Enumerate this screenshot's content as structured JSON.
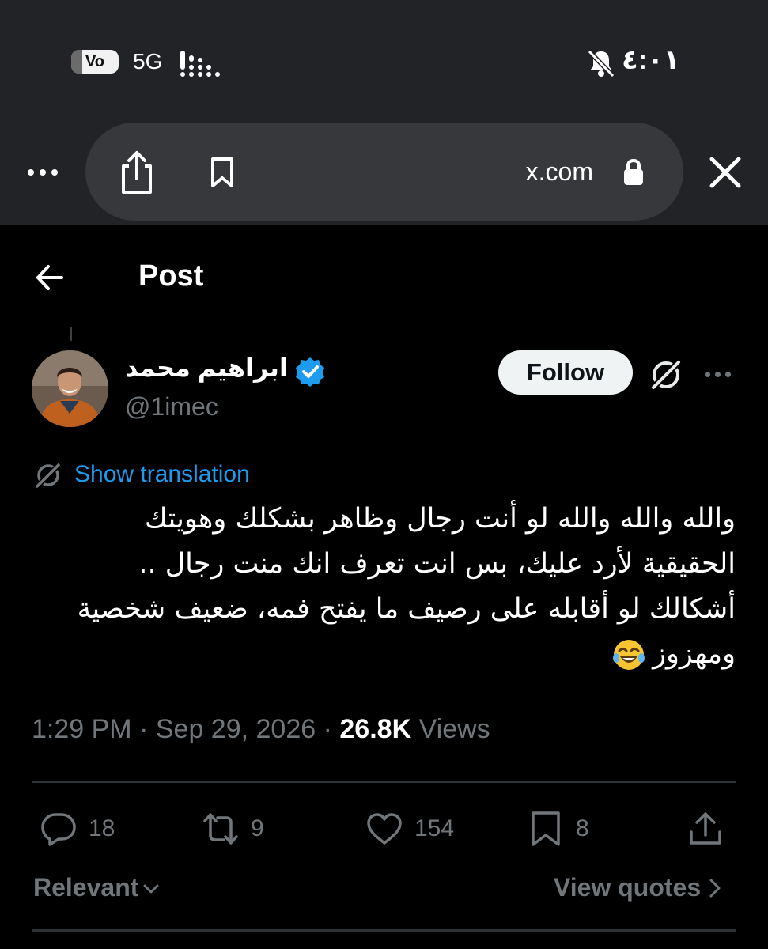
{
  "status_bar": {
    "carrier_label": "Vo",
    "network": "5G",
    "time": "٤:٠١"
  },
  "browser": {
    "url": "x.com"
  },
  "header": {
    "title": "Post"
  },
  "post": {
    "display_name": "ابراهيم محمد",
    "handle": "@1imec",
    "follow_label": "Follow",
    "show_translation": "Show translation",
    "text_line_1": "والله والله والله لو أنت رجال وظاهر بشكلك وهويتك",
    "text_line_2": "الحقيقية لأرد عليك، بس انت تعرف انك منت رجال ..",
    "text_line_3": "أشكالك لو أقابله على رصيف ما يفتح فمه، ضعيف شخصية",
    "text_line_4": "ومهزوز",
    "time": "1:29 PM",
    "date": "Sep 29, 2026",
    "views_count": "26.8K",
    "views_label": "Views"
  },
  "actions": {
    "replies": "18",
    "reposts": "9",
    "likes": "154",
    "bookmarks": "8"
  },
  "footer": {
    "sort_label": "Relevant",
    "view_quotes": "View quotes"
  },
  "colors": {
    "accent": "#1d9bf0",
    "muted": "#71767b",
    "follow_bg": "#eff3f4"
  },
  "icons": [
    "more-icon",
    "share-icon",
    "bookmark-icon",
    "lock-icon",
    "close-icon",
    "back-arrow-icon",
    "verified-icon",
    "grok-icon",
    "translate-icon",
    "reply-icon",
    "repost-icon",
    "like-icon",
    "chevron-down-icon",
    "chevron-right-icon",
    "bell-muted-icon",
    "signal-icon",
    "laughing-emoji"
  ]
}
